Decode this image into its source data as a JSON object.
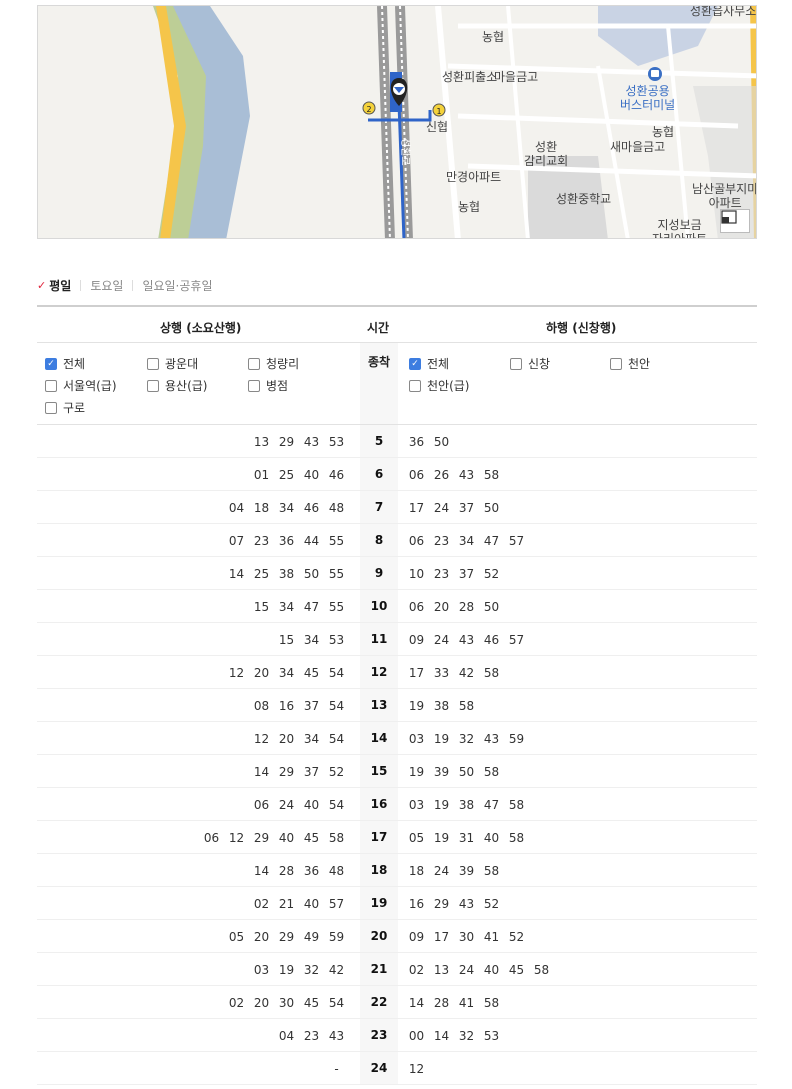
{
  "map": {
    "labels": {
      "office": "성환읍사무소",
      "nh1": "농협",
      "police": "성환피출소",
      "saemaeul1": "마을금고",
      "terminal": "성환공용\n버스터미널",
      "shinhyup": "신협",
      "church": "성환\n감리교회",
      "nh2": "농협",
      "saemaeul2": "새마을금고",
      "mankyung": "만경아파트",
      "nh3": "농협",
      "middle_school": "성환중학교",
      "namsan": "남산골부지마\n아파트",
      "jiseong": "지성보금\n자리아파트",
      "road": "성환로",
      "marker1": "1",
      "marker2": "2"
    }
  },
  "tabs": [
    {
      "label": "평일",
      "active": true
    },
    {
      "label": "토요일",
      "active": false
    },
    {
      "label": "일요일·공휴일",
      "active": false
    }
  ],
  "table": {
    "head_up": "상행 (소요산행)",
    "head_time": "시간",
    "head_down": "하행 (신창행)",
    "terminal_label": "종착",
    "up_filters": [
      {
        "label": "전체",
        "checked": true
      },
      {
        "label": "광운대",
        "checked": false
      },
      {
        "label": "청량리",
        "checked": false
      },
      {
        "label": "서울역(급)",
        "checked": false
      },
      {
        "label": "용산(급)",
        "checked": false
      },
      {
        "label": "병점",
        "checked": false
      },
      {
        "label": "구로",
        "checked": false
      }
    ],
    "down_filters": [
      {
        "label": "전체",
        "checked": true
      },
      {
        "label": "신창",
        "checked": false
      },
      {
        "label": "천안",
        "checked": false
      },
      {
        "label": "천안(급)",
        "checked": false
      }
    ],
    "rows": [
      {
        "hour": "5",
        "up": [
          "13",
          "29",
          "43",
          "53"
        ],
        "down": [
          "36",
          "50"
        ]
      },
      {
        "hour": "6",
        "up": [
          "01",
          "25",
          "40",
          "46"
        ],
        "down": [
          "06",
          "26",
          "43",
          "58"
        ]
      },
      {
        "hour": "7",
        "up": [
          "04",
          "18",
          "34",
          "46",
          "48"
        ],
        "down": [
          "17",
          "24",
          "37",
          "50"
        ]
      },
      {
        "hour": "8",
        "up": [
          "07",
          "23",
          "36",
          "44",
          "55"
        ],
        "down": [
          "06",
          "23",
          "34",
          "47",
          "57"
        ]
      },
      {
        "hour": "9",
        "up": [
          "14",
          "25",
          "38",
          "50",
          "55"
        ],
        "down": [
          "10",
          "23",
          "37",
          "52"
        ]
      },
      {
        "hour": "10",
        "up": [
          "15",
          "34",
          "47",
          "55"
        ],
        "down": [
          "06",
          "20",
          "28",
          "50"
        ]
      },
      {
        "hour": "11",
        "up": [
          "15",
          "34",
          "53"
        ],
        "down": [
          "09",
          "24",
          "43",
          "46",
          "57"
        ]
      },
      {
        "hour": "12",
        "up": [
          "12",
          "20",
          "34",
          "45",
          "54"
        ],
        "down": [
          "17",
          "33",
          "42",
          "58"
        ]
      },
      {
        "hour": "13",
        "up": [
          "08",
          "16",
          "37",
          "54"
        ],
        "down": [
          "19",
          "38",
          "58"
        ]
      },
      {
        "hour": "14",
        "up": [
          "12",
          "20",
          "34",
          "54"
        ],
        "down": [
          "03",
          "19",
          "32",
          "43",
          "59"
        ]
      },
      {
        "hour": "15",
        "up": [
          "14",
          "29",
          "37",
          "52"
        ],
        "down": [
          "19",
          "39",
          "50",
          "58"
        ]
      },
      {
        "hour": "16",
        "up": [
          "06",
          "24",
          "40",
          "54"
        ],
        "down": [
          "03",
          "19",
          "38",
          "47",
          "58"
        ]
      },
      {
        "hour": "17",
        "up": [
          "06",
          "12",
          "29",
          "40",
          "45",
          "58"
        ],
        "down": [
          "05",
          "19",
          "31",
          "40",
          "58"
        ]
      },
      {
        "hour": "18",
        "up": [
          "14",
          "28",
          "36",
          "48"
        ],
        "down": [
          "18",
          "24",
          "39",
          "58"
        ]
      },
      {
        "hour": "19",
        "up": [
          "02",
          "21",
          "40",
          "57"
        ],
        "down": [
          "16",
          "29",
          "43",
          "52"
        ]
      },
      {
        "hour": "20",
        "up": [
          "05",
          "20",
          "29",
          "49",
          "59"
        ],
        "down": [
          "09",
          "17",
          "30",
          "41",
          "52"
        ]
      },
      {
        "hour": "21",
        "up": [
          "03",
          "19",
          "32",
          "42"
        ],
        "down": [
          "02",
          "13",
          "24",
          "40",
          "45",
          "58"
        ]
      },
      {
        "hour": "22",
        "up": [
          "02",
          "20",
          "30",
          "45",
          "54"
        ],
        "down": [
          "14",
          "28",
          "41",
          "58"
        ]
      },
      {
        "hour": "23",
        "up": [
          "04",
          "23",
          "43"
        ],
        "down": [
          "00",
          "14",
          "32",
          "53"
        ]
      },
      {
        "hour": "24",
        "up": [
          "-"
        ],
        "down": [
          "12"
        ]
      }
    ]
  }
}
